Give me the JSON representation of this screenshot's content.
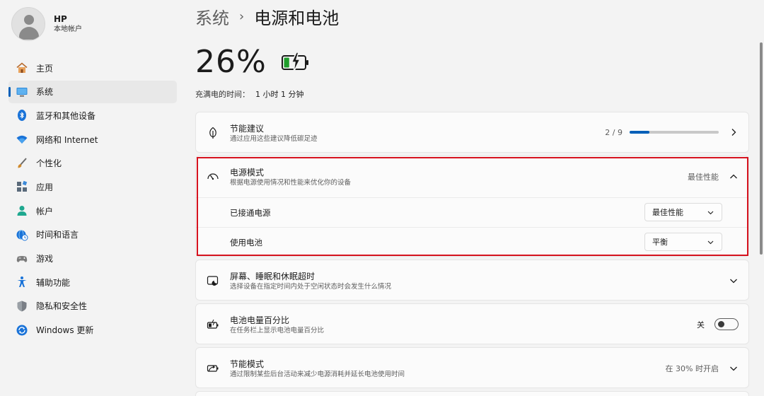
{
  "profile": {
    "name": "HP",
    "account_type": "本地帐户"
  },
  "sidebar": {
    "items": [
      {
        "label": "主页",
        "icon": "home-icon"
      },
      {
        "label": "系统",
        "icon": "system-icon",
        "active": true
      },
      {
        "label": "蓝牙和其他设备",
        "icon": "bluetooth-icon"
      },
      {
        "label": "网络和 Internet",
        "icon": "wifi-icon"
      },
      {
        "label": "个性化",
        "icon": "brush-icon"
      },
      {
        "label": "应用",
        "icon": "apps-icon"
      },
      {
        "label": "帐户",
        "icon": "account-icon"
      },
      {
        "label": "时间和语言",
        "icon": "globe-clock-icon"
      },
      {
        "label": "游戏",
        "icon": "gamepad-icon"
      },
      {
        "label": "辅助功能",
        "icon": "accessibility-icon"
      },
      {
        "label": "隐私和安全性",
        "icon": "shield-icon"
      },
      {
        "label": "Windows 更新",
        "icon": "update-icon"
      }
    ]
  },
  "breadcrumb": {
    "parent": "系统",
    "separator": "›",
    "current": "电源和电池"
  },
  "battery": {
    "percent_label": "26%",
    "level": 0.26,
    "charging": true,
    "charge_time_label": "充满电的时间：",
    "charge_time_value": "1 小时 1 分钟"
  },
  "energy_recommendations": {
    "title": "节能建议",
    "subtitle": "通过应用这些建议降低碳足迹",
    "progress_text": "2 / 9",
    "progress_fraction": 0.222
  },
  "power_mode": {
    "title": "电源模式",
    "subtitle": "根据电源使用情况和性能来优化你的设备",
    "current_value": "最佳性能",
    "plugged_in_label": "已接通电源",
    "plugged_in_value": "最佳性能",
    "on_battery_label": "使用电池",
    "on_battery_value": "平衡"
  },
  "screen_sleep": {
    "title": "屏幕、睡眠和休眠超时",
    "subtitle": "选择设备在指定时间内处于空闲状态时会发生什么情况"
  },
  "battery_percentage": {
    "title": "电池电量百分比",
    "subtitle": "在任务栏上显示电池电量百分比",
    "toggle_state": "关"
  },
  "battery_saver": {
    "title": "节能模式",
    "subtitle": "通过限制某些后台活动来减少电源消耗并延长电池使用时间",
    "status": "在 30% 时开启"
  },
  "colors": {
    "accent": "#005fb8",
    "highlight": "#d6121e",
    "battery_green": "#1f9e2c"
  }
}
